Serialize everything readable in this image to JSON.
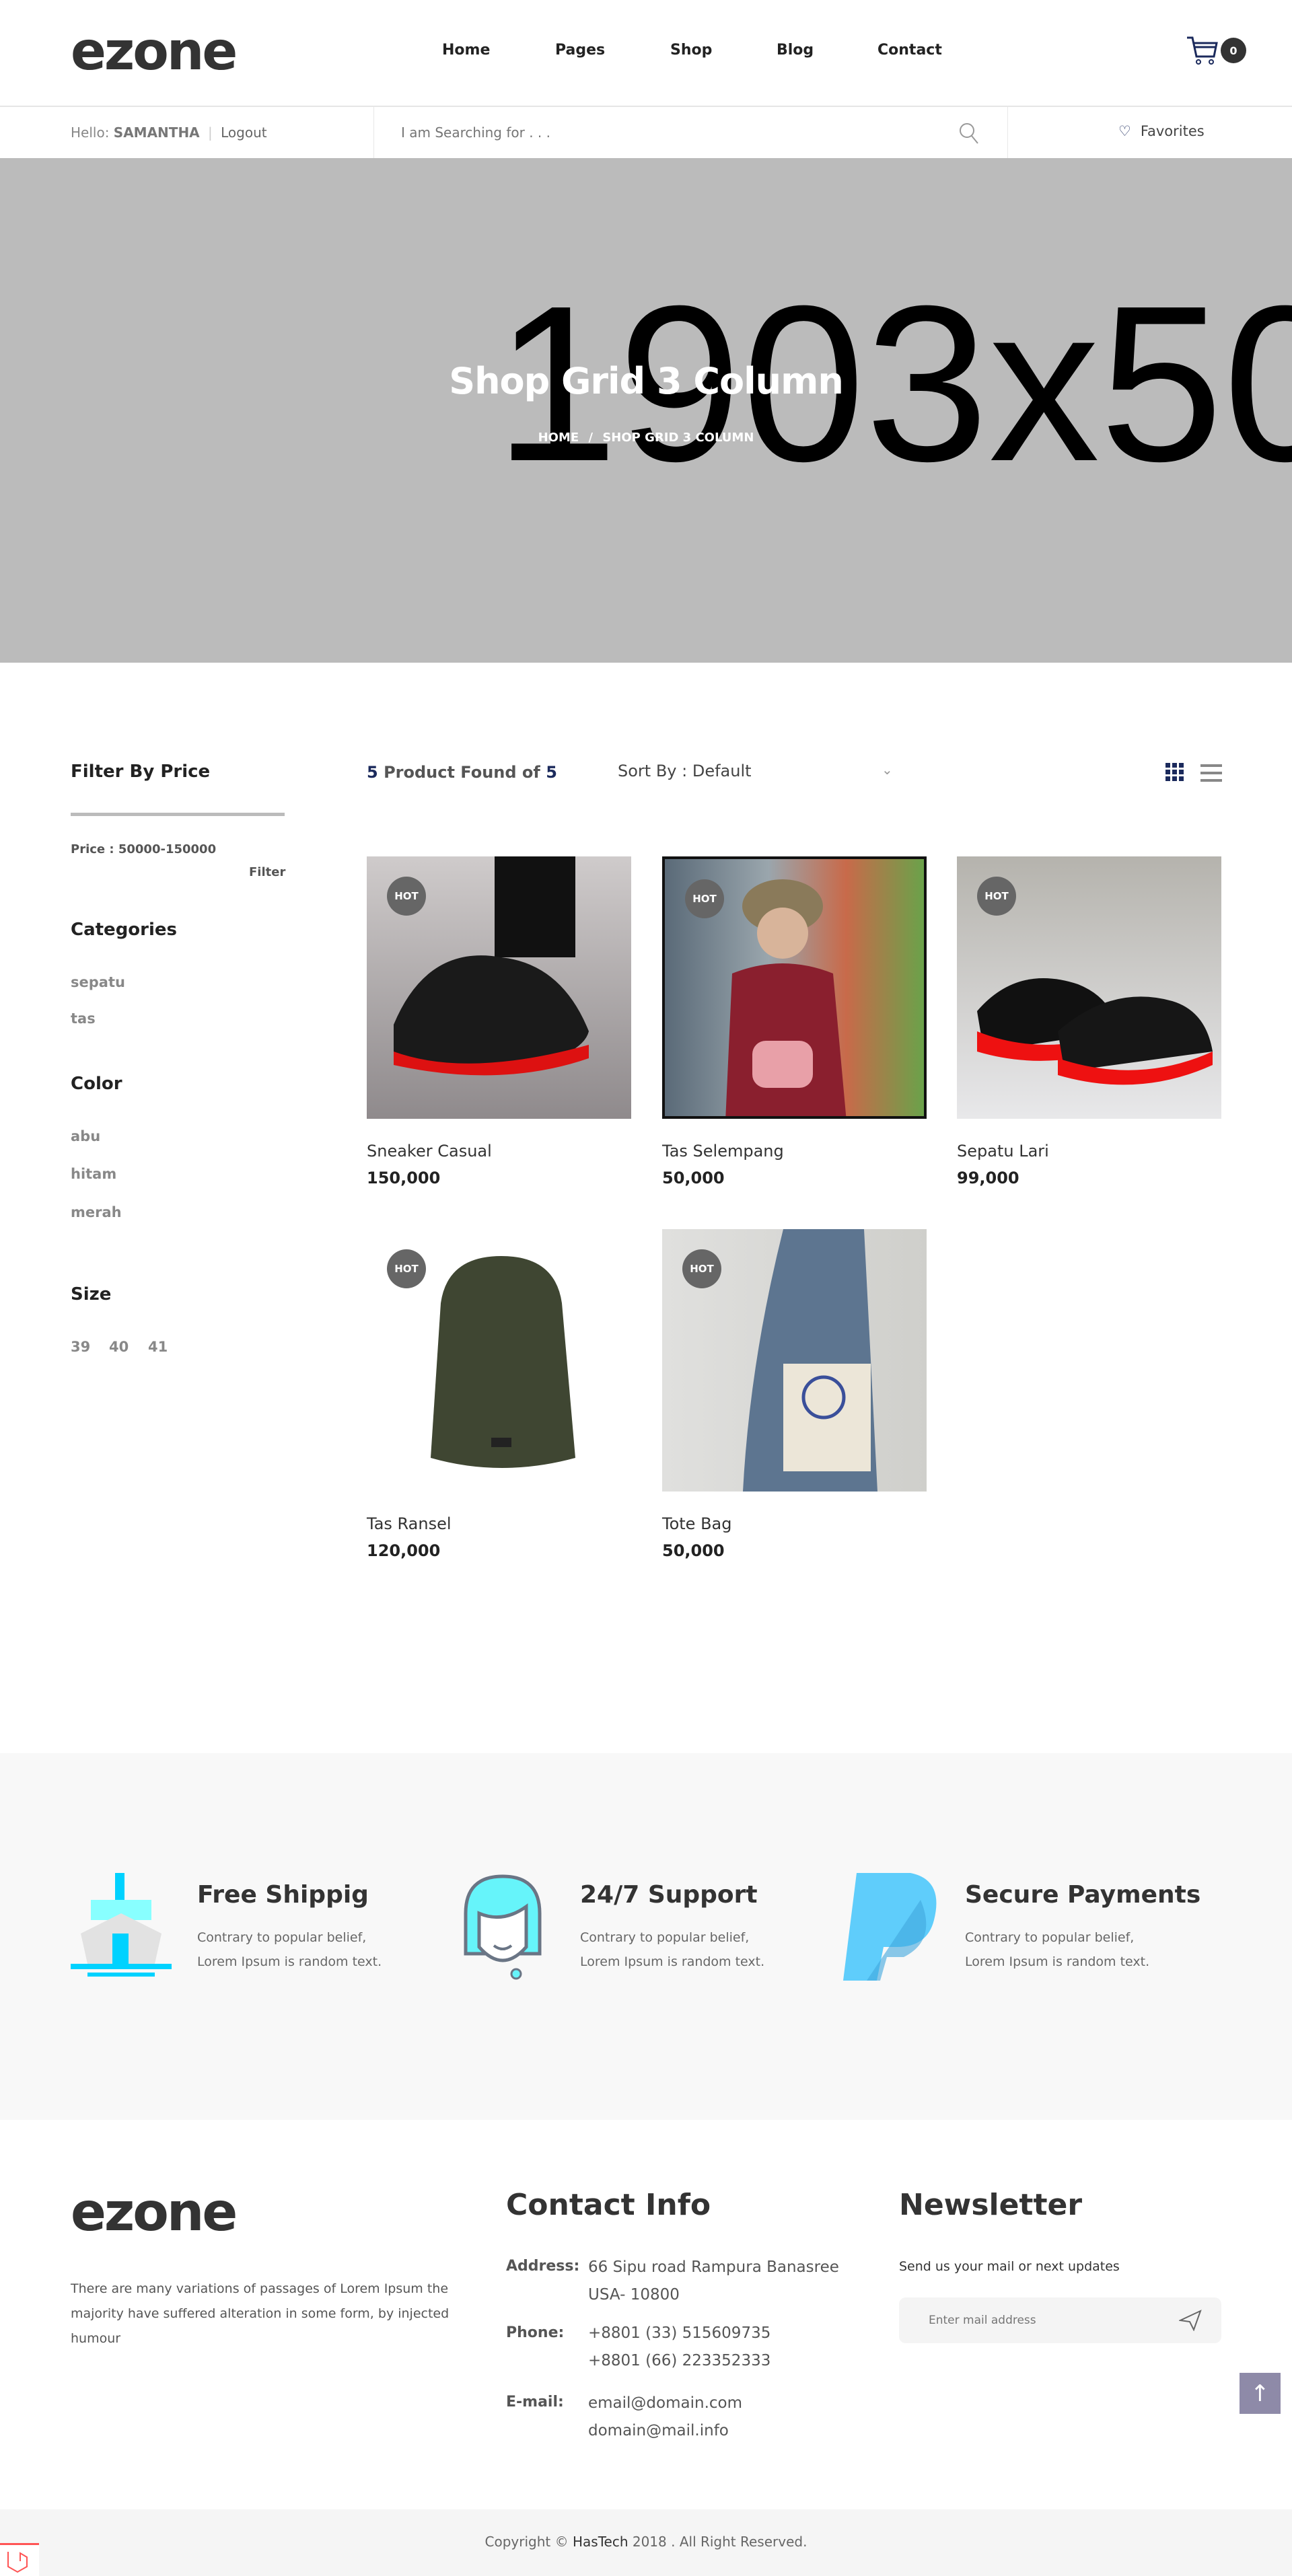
{
  "header": {
    "logo": "ezone",
    "nav": [
      "Home",
      "Pages",
      "Shop",
      "Blog",
      "Contact"
    ],
    "cart_count": "0"
  },
  "subbar": {
    "hello": "Hello:",
    "user": "SAMANTHA",
    "logout": "Logout",
    "search_placeholder": "I am Searching for . . .",
    "favorites": "Favorites"
  },
  "hero": {
    "placeholder_text": "1903x50",
    "title": "Shop Grid 3 Column",
    "breadcrumb": [
      "HOME",
      "SHOP GRID 3 COLUMN"
    ],
    "breadcrumb_sep": "/"
  },
  "sidebar": {
    "filter_title": "Filter By Price",
    "price_label": "Price : 50000-150000",
    "filter_button": "Filter",
    "categories_title": "Categories",
    "categories": [
      "sepatu",
      "tas"
    ],
    "color_title": "Color",
    "colors": [
      "abu",
      "hitam",
      "merah"
    ],
    "size_title": "Size",
    "sizes": [
      "39",
      "40",
      "41"
    ]
  },
  "toolbar": {
    "found_count": "5",
    "found_text": "Product Found of",
    "found_total": "5",
    "sort_label": "Sort By : Default"
  },
  "products": [
    {
      "name": "Sneaker Casual",
      "price": "150,000",
      "badge": "HOT"
    },
    {
      "name": "Tas Selempang",
      "price": "50,000",
      "badge": "HOT"
    },
    {
      "name": "Sepatu Lari",
      "price": "99,000",
      "badge": "HOT"
    },
    {
      "name": "Tas Ransel",
      "price": "120,000",
      "badge": "HOT"
    },
    {
      "name": "Tote Bag",
      "price": "50,000",
      "badge": "HOT"
    }
  ],
  "features": [
    {
      "title": "Free Shippig",
      "text": "Contrary to popular belief, Lorem Ipsum is random text.",
      "icon": "ship-icon"
    },
    {
      "title": "24/7 Support",
      "text": "Contrary to popular belief, Lorem Ipsum is random text.",
      "icon": "support-agent-icon"
    },
    {
      "title": "Secure Payments",
      "text": "Contrary to popular belief, Lorem Ipsum is random text.",
      "icon": "paypal-icon"
    }
  ],
  "footer": {
    "logo": "ezone",
    "about": "There are many variations of passages of Lorem Ipsum the majority have suffered alteration in some form, by injected humour",
    "contact_title": "Contact Info",
    "address_label": "Address:",
    "address": [
      "66 Sipu road Rampura Banasree",
      "USA- 10800"
    ],
    "phone_label": "Phone:",
    "phones": [
      "+8801 (33) 515609735",
      "+8801 (66) 223352333"
    ],
    "email_label": "E-mail:",
    "emails": [
      "email@domain.com",
      "domain@mail.info"
    ],
    "newsletter_title": "Newsletter",
    "newsletter_text": "Send us your mail or next updates",
    "newsletter_placeholder": "Enter mail address",
    "copyright_pre": "Copyright ©",
    "copyright_brand": "HasTech",
    "copyright_post": "2018 . All Right Reserved."
  },
  "colors": {
    "hero_bg": "#bbbbbb",
    "badge": "#666666",
    "cart": "#1b2a5c",
    "scroll_top": "#8e8aa8",
    "feature_bg": "#f8f8f8"
  }
}
